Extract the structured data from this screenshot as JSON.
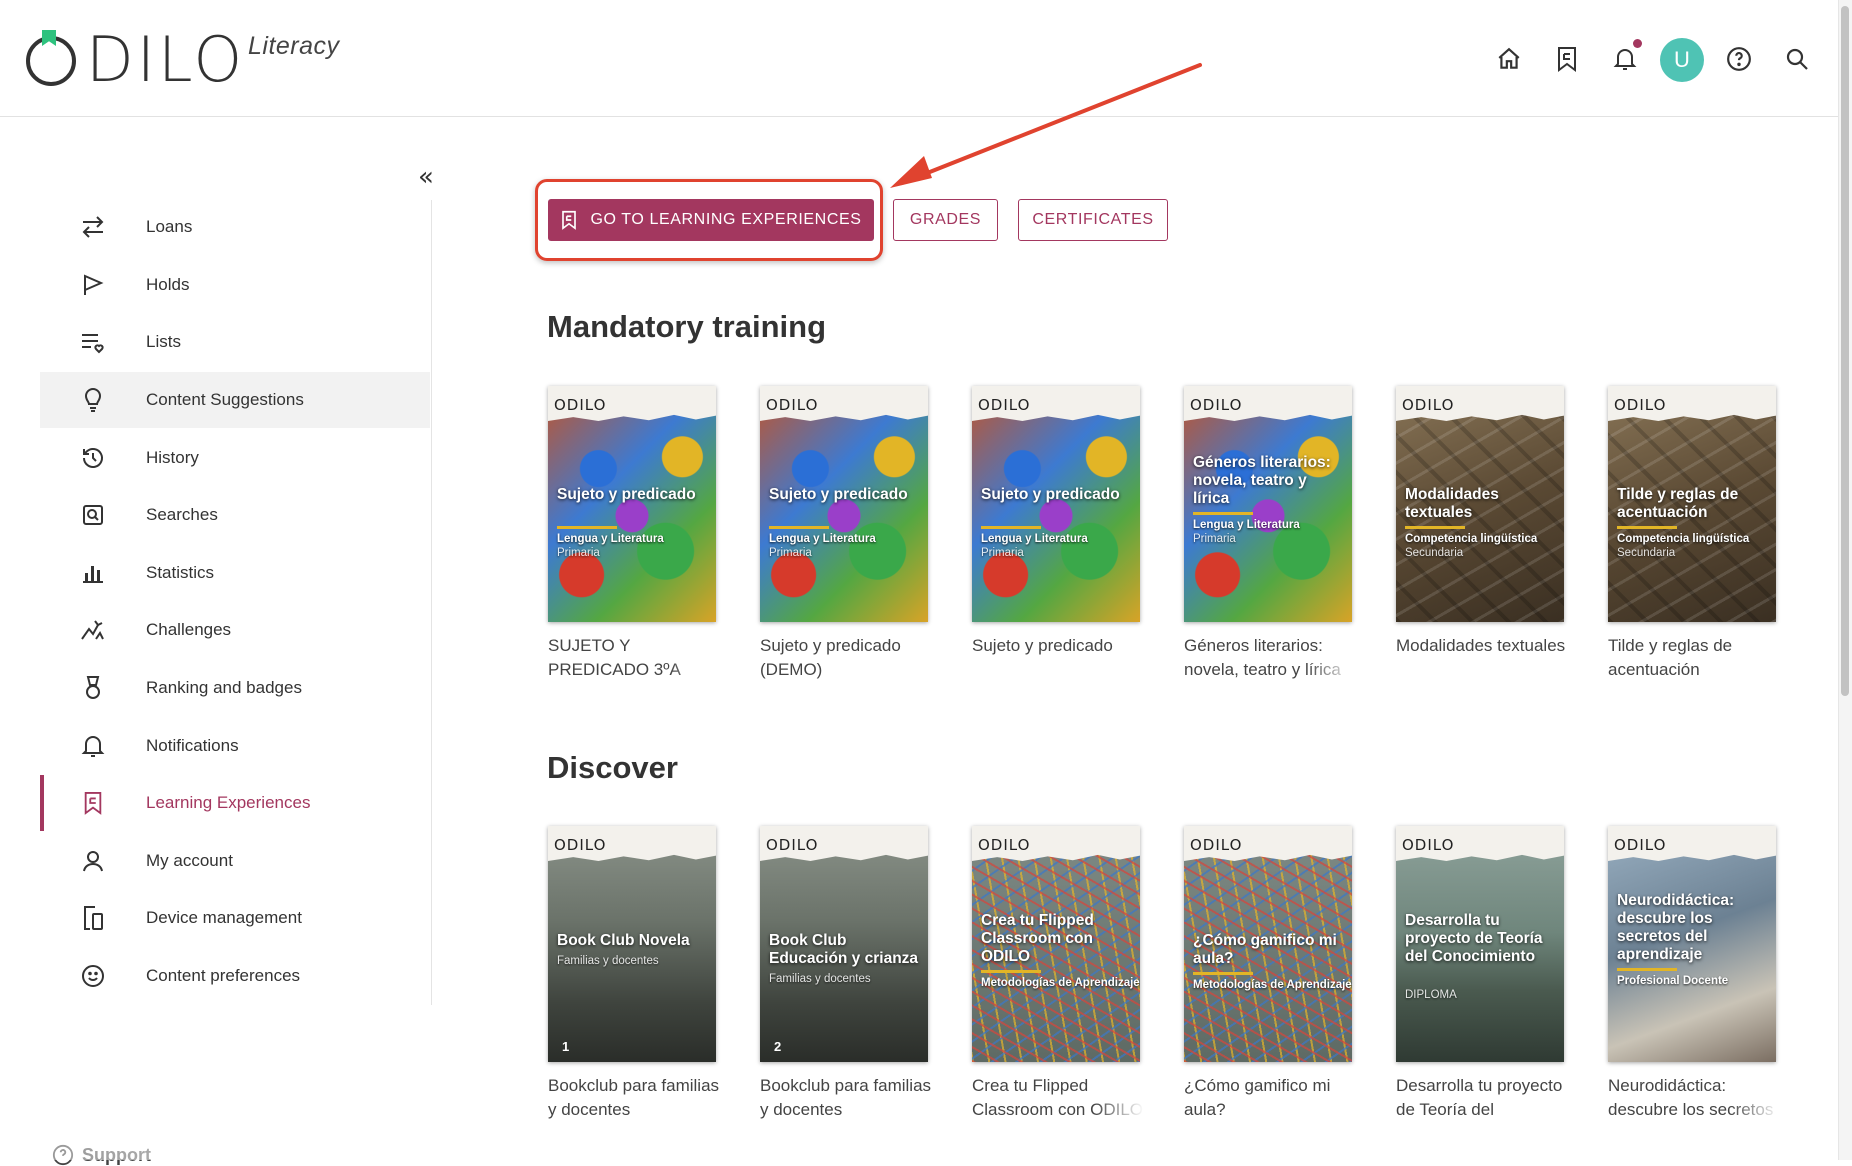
{
  "brand": {
    "logo_text": "DILO",
    "product": "Literacy"
  },
  "header_icons": [
    "home-icon",
    "learning-bookmark-icon",
    "bell-icon",
    "avatar",
    "help-icon",
    "search-icon"
  ],
  "user": {
    "initial": "U"
  },
  "sidebar": {
    "collapse_glyph": "«",
    "items": [
      {
        "label": "Loans",
        "icon": "swap-arrows-icon"
      },
      {
        "label": "Holds",
        "icon": "flag-icon"
      },
      {
        "label": "Lists",
        "icon": "list-heart-icon"
      },
      {
        "label": "Content Suggestions",
        "icon": "lightbulb-icon",
        "selected": true
      },
      {
        "label": "History",
        "icon": "history-icon"
      },
      {
        "label": "Searches",
        "icon": "saved-search-icon"
      },
      {
        "label": "Statistics",
        "icon": "bar-chart-icon"
      },
      {
        "label": "Challenges",
        "icon": "challenge-icon"
      },
      {
        "label": "Ranking and badges",
        "icon": "medal-icon"
      },
      {
        "label": "Notifications",
        "icon": "bell-icon"
      },
      {
        "label": "Learning Experiences",
        "icon": "learning-bookmark-icon",
        "active": true
      },
      {
        "label": "My account",
        "icon": "user-icon"
      },
      {
        "label": "Device management",
        "icon": "devices-icon"
      },
      {
        "label": "Content preferences",
        "icon": "smiley-icon"
      }
    ],
    "support_label": "Support"
  },
  "actions": {
    "primary": "GO TO LEARNING EXPERIENCES",
    "grades": "GRADES",
    "certificates": "CERTIFICATES"
  },
  "colors": {
    "accent": "#a3375f",
    "annotation": "#e0432f",
    "avatar": "#4fc3b4"
  },
  "sections": [
    {
      "title": "Mandatory training",
      "cards": [
        {
          "cover_title": "Sujeto y predicado",
          "cover_subject": "Lengua y Literatura",
          "cover_level": "Primaria",
          "title": "SUJETO Y PREDICADO 3ºA"
        },
        {
          "cover_title": "Sujeto y predicado",
          "cover_subject": "Lengua y Literatura",
          "cover_level": "Primaria",
          "title": "Sujeto y predicado (DEMO)"
        },
        {
          "cover_title": "Sujeto y predicado",
          "cover_subject": "Lengua y Literatura",
          "cover_level": "Primaria",
          "title": "Sujeto y predicado"
        },
        {
          "cover_title": "Géneros literarios: novela, teatro y lírica",
          "cover_subject": "Lengua y Literatura",
          "cover_level": "Primaria",
          "title": "Géneros literarios: novela, teatro y lírica"
        },
        {
          "cover_title": "Modalidades textuales",
          "cover_subject": "Competencia lingüística",
          "cover_level": "Secundaria",
          "title": "Modalidades textuales"
        },
        {
          "cover_title": "Tilde y reglas de acentuación",
          "cover_subject": "Competencia lingüística",
          "cover_level": "Secundaria",
          "title": "Tilde y reglas de acentuación"
        }
      ]
    },
    {
      "title": "Discover",
      "cards": [
        {
          "cover_title": "Book Club Novela",
          "cover_subject": "",
          "cover_level": "Familias y docentes",
          "cover_num": "1",
          "title": "Bookclub para familias y docentes"
        },
        {
          "cover_title": "Book Club Educación y crianza",
          "cover_subject": "",
          "cover_level": "Familias y docentes",
          "cover_num": "2",
          "title": "Bookclub para familias y docentes"
        },
        {
          "cover_title": "Crea tu Flipped Classroom con ODILO",
          "cover_subject": "Metodologías de Aprendizaje",
          "cover_level": "",
          "title": "Crea tu Flipped Classroom con ODILO"
        },
        {
          "cover_title": "¿Cómo gamifico mi aula?",
          "cover_subject": "Metodologías de Aprendizaje",
          "cover_level": "",
          "title": "¿Cómo gamifico mi aula?"
        },
        {
          "cover_title": "Desarrolla tu proyecto de Teoría del Conocimiento",
          "cover_subject": "",
          "cover_level": "DIPLOMA",
          "title": "Desarrolla tu proyecto de Teoría del Conocimiento"
        },
        {
          "cover_title": "Neurodidáctica: descubre los secretos del aprendizaje",
          "cover_subject": "Profesional Docente",
          "cover_level": "",
          "title": "Neurodidáctica: descubre los secretos del aprendizaje"
        }
      ]
    }
  ],
  "cover_brand": "ODILO"
}
